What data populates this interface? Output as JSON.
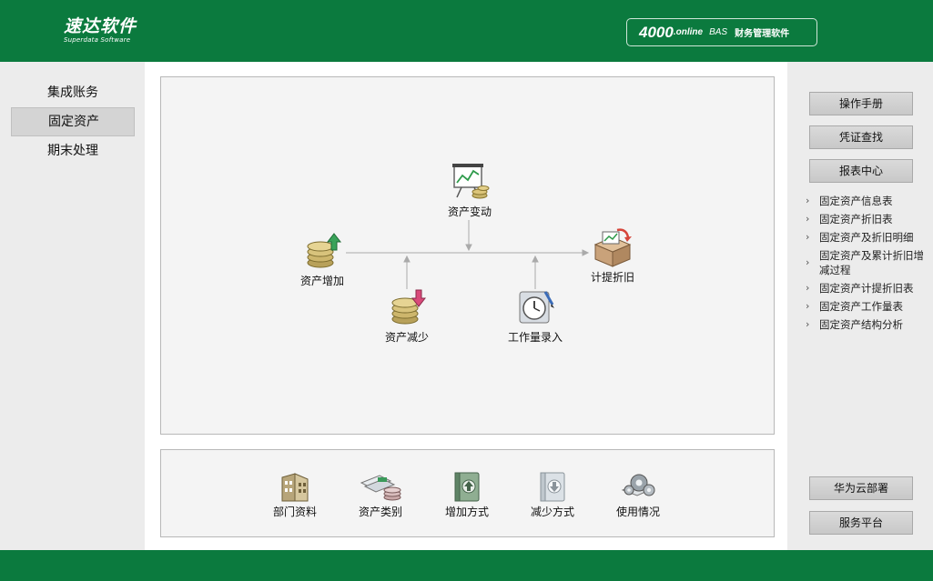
{
  "header": {
    "logo_cn": "速达软件",
    "logo_en": "Superdata Software",
    "badge_num": "4000",
    "badge_online": ".online",
    "badge_bas": "BAS",
    "badge_cn": "财务管理软件"
  },
  "nav": [
    {
      "label": "集成账务",
      "active": false
    },
    {
      "label": "固定资产",
      "active": true
    },
    {
      "label": "期末处理",
      "active": false
    }
  ],
  "flow": {
    "asset_change": "资产变动",
    "asset_add": "资产增加",
    "depreciation": "计提折旧",
    "asset_reduce": "资产减少",
    "workload": "工作量录入"
  },
  "tools": [
    "部门资料",
    "资产类别",
    "增加方式",
    "减少方式",
    "使用情况"
  ],
  "right": {
    "manual": "操作手册",
    "voucher": "凭证查找",
    "report_center": "报表中心",
    "reports": [
      "固定资产信息表",
      "固定资产折旧表",
      "固定资产及折旧明细",
      "固定资产及累计折旧增减过程",
      "固定资产计提折旧表",
      "固定资产工作量表",
      "固定资产结构分析"
    ],
    "huawei": "华为云部署",
    "service": "服务平台"
  },
  "colors": {
    "brand_green": "#0b7a3e",
    "panel_bg": "#f4f4f4",
    "sidebar_bg": "#ececec"
  }
}
